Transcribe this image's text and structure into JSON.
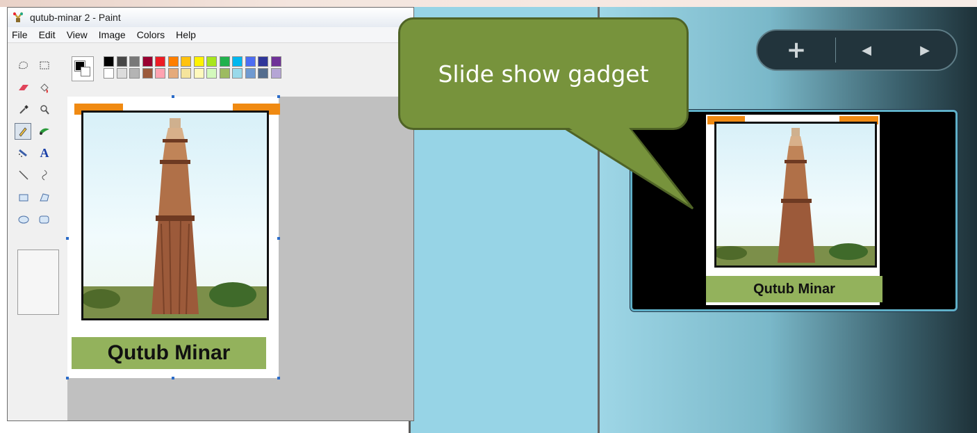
{
  "window": {
    "title": "qutub-minar 2 - Paint",
    "icon": "paint-palette-icon"
  },
  "menu": [
    "File",
    "Edit",
    "View",
    "Image",
    "Colors",
    "Help"
  ],
  "tools": [
    {
      "name": "free-form-select-icon",
      "glyph": "◌"
    },
    {
      "name": "rect-select-icon",
      "glyph": "⬚"
    },
    {
      "name": "eraser-icon",
      "glyph": "▰"
    },
    {
      "name": "fill-bucket-icon",
      "glyph": "◈"
    },
    {
      "name": "color-picker-icon",
      "glyph": "✎"
    },
    {
      "name": "magnifier-icon",
      "glyph": "⌕"
    },
    {
      "name": "pencil-icon",
      "glyph": "✏"
    },
    {
      "name": "brush-icon",
      "glyph": "❧"
    },
    {
      "name": "airbrush-icon",
      "glyph": "✐"
    },
    {
      "name": "text-icon",
      "glyph": "A"
    },
    {
      "name": "line-icon",
      "glyph": "╲"
    },
    {
      "name": "curve-icon",
      "glyph": "∫"
    },
    {
      "name": "rectangle-icon",
      "glyph": "▭"
    },
    {
      "name": "polygon-icon",
      "glyph": "⏢"
    },
    {
      "name": "ellipse-icon",
      "glyph": "⬭"
    },
    {
      "name": "rounded-rect-icon",
      "glyph": "▢"
    }
  ],
  "palette": {
    "top": [
      "#000000",
      "#464646",
      "#787878",
      "#990030",
      "#ed1c24",
      "#ff7e00",
      "#ffc20e",
      "#fff200",
      "#a8e61d",
      "#22b14c",
      "#00b7ef",
      "#4d6df3",
      "#2f3699",
      "#6f3198"
    ],
    "bottom": [
      "#ffffff",
      "#dcdcdc",
      "#b4b4b4",
      "#9c5a3c",
      "#ffa3b1",
      "#e5aa7a",
      "#f5e49c",
      "#fff9bd",
      "#d3f9bc",
      "#9dbb61",
      "#99d9ea",
      "#709ad1",
      "#546d8e",
      "#b5a5d5"
    ],
    "fg": "#000000",
    "bg": "#ffffff"
  },
  "paint_card": {
    "caption": "Qutub Minar"
  },
  "gadget": {
    "caption": "Qutub Minar",
    "add_icon": "plus-icon",
    "prev_icon": "previous-icon",
    "next_icon": "next-icon",
    "add_glyph": "+",
    "prev_glyph": "◀",
    "next_glyph": "▶"
  },
  "callout": {
    "text": "Slide show gadget"
  }
}
